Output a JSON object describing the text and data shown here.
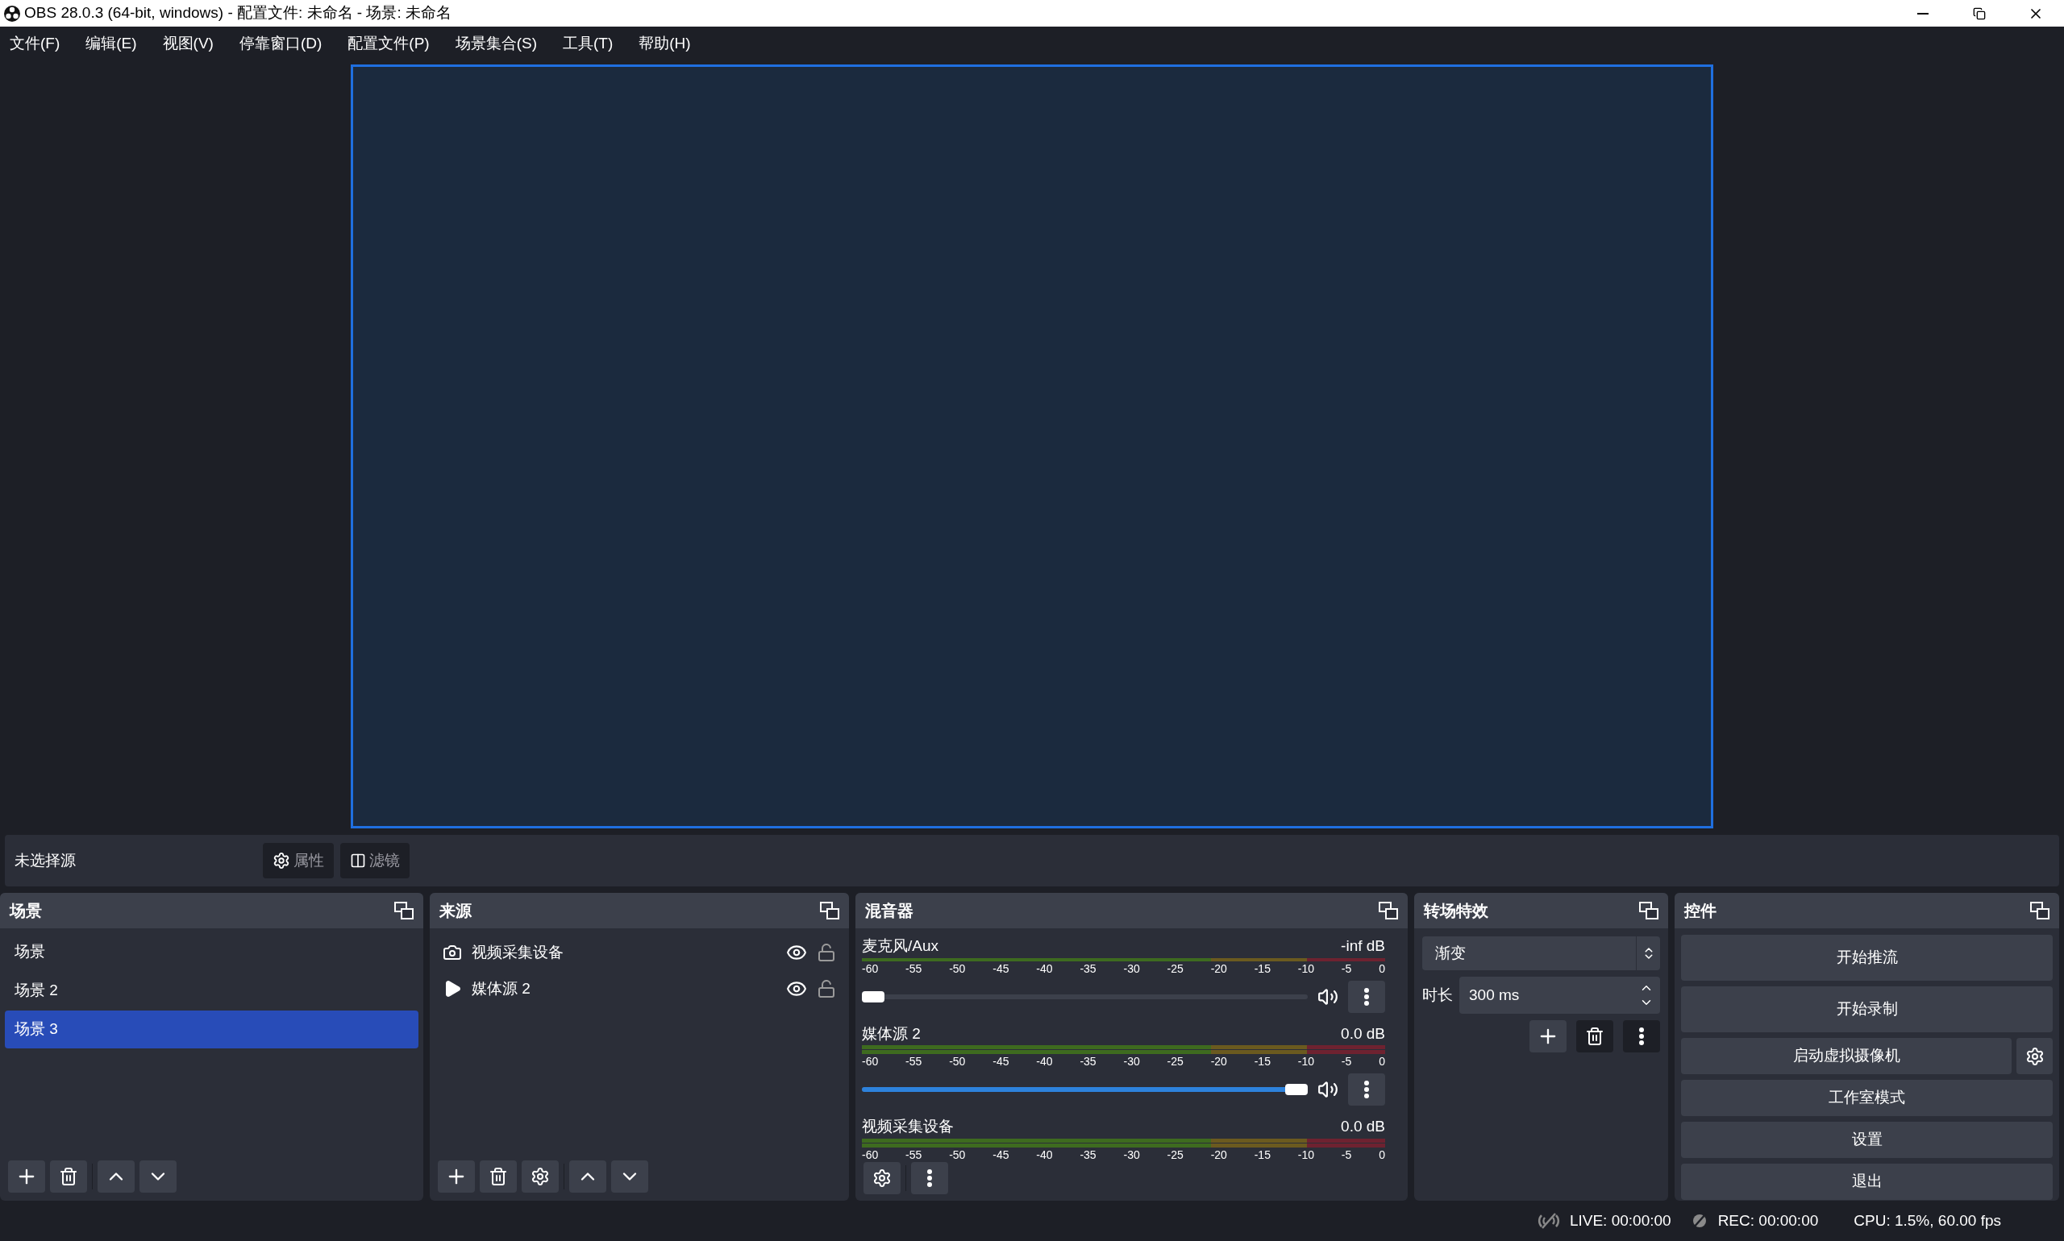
{
  "window": {
    "title": "OBS 28.0.3 (64-bit, windows) - 配置文件: 未命名 - 场景: 未命名"
  },
  "menu": [
    "文件(F)",
    "编辑(E)",
    "视图(V)",
    "停靠窗口(D)",
    "配置文件(P)",
    "场景集合(S)",
    "工具(T)",
    "帮助(H)"
  ],
  "source_bar": {
    "label": "未选择源",
    "buttons": [
      {
        "kind": "properties",
        "label": "属性"
      },
      {
        "kind": "filters",
        "label": "滤镜"
      }
    ]
  },
  "scenes": {
    "title": "场景",
    "items": [
      {
        "name": "场景",
        "selected": false
      },
      {
        "name": "场景 2",
        "selected": false
      },
      {
        "name": "场景 3",
        "selected": true
      }
    ]
  },
  "sources": {
    "title": "来源",
    "items": [
      {
        "kind": "camera",
        "name": "视频采集设备",
        "visible": true,
        "locked": false
      },
      {
        "kind": "media",
        "name": "媒体源 2",
        "visible": true,
        "locked": false
      }
    ]
  },
  "mixer": {
    "title": "混音器",
    "channels": [
      {
        "name": "麦克风/Aux",
        "reading": "-inf dB",
        "stereo": false,
        "scale": [
          "-60",
          "-55",
          "-50",
          "-45",
          "-40",
          "-35",
          "-30",
          "-25",
          "-20",
          "-15",
          "-10",
          "-5",
          "0"
        ],
        "volume": {
          "level": 0
        }
      },
      {
        "name": "媒体源 2",
        "reading": "0.0 dB",
        "stereo": true,
        "scale": [
          "-60",
          "-55",
          "-50",
          "-45",
          "-40",
          "-35",
          "-30",
          "-25",
          "-20",
          "-15",
          "-10",
          "-5",
          "0"
        ],
        "volume": {
          "level": 1
        }
      },
      {
        "name": "视频采集设备",
        "reading": "0.0 dB",
        "stereo": true,
        "scale": [
          "-60",
          "-55",
          "-50",
          "-45",
          "-40",
          "-35",
          "-30",
          "-25",
          "-20",
          "-15",
          "-10",
          "-5",
          "0"
        ]
      }
    ]
  },
  "transitions": {
    "title": "转场特效",
    "selected": "渐变",
    "duration_label": "时长",
    "duration": "300 ms"
  },
  "controls": {
    "title": "控件",
    "buttons": [
      {
        "label": "开始推流",
        "has_settings": false
      },
      {
        "label": "开始录制",
        "has_settings": false
      },
      {
        "label": "启动虚拟摄像机",
        "has_settings": true
      },
      {
        "label": "工作室模式",
        "has_settings": false
      },
      {
        "label": "设置",
        "has_settings": false
      },
      {
        "label": "退出",
        "has_settings": false
      }
    ]
  },
  "status_bar": {
    "live": "LIVE: 00:00:00",
    "rec": "REC: 00:00:00",
    "cpu": "CPU: 1.5%, 60.00 fps"
  }
}
